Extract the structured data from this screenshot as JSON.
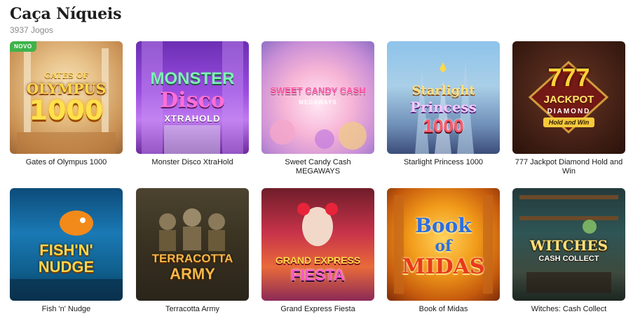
{
  "page": {
    "title": "Caça Níqueis",
    "count": "3937 Jogos"
  },
  "games": [
    {
      "name": "Gates of Olympus 1000",
      "badge": "NOVO",
      "logo_lines": [
        "GATES OF",
        "OLYMPUS",
        "1000"
      ]
    },
    {
      "name": "Monster Disco XtraHold",
      "logo_lines": [
        "MONSTER",
        "Disco",
        "XTRAHOLD"
      ]
    },
    {
      "name": "Sweet Candy Cash MEGAWAYS",
      "logo_lines": [
        "SWEET CANDY CASH",
        "MEGAWAYS"
      ]
    },
    {
      "name": "Starlight Princess 1000",
      "logo_lines": [
        "Starlight",
        "Princess",
        "1000"
      ]
    },
    {
      "name": "777 Jackpot Diamond Hold and Win",
      "logo_lines": [
        "777",
        "JACKPOT",
        "DIAMOND",
        "Hold and Win"
      ]
    },
    {
      "name": "Fish 'n' Nudge",
      "logo_lines": [
        "FISH'N'",
        "NUDGE"
      ]
    },
    {
      "name": "Terracotta Army",
      "logo_lines": [
        "TERRACOTTA",
        "ARMY"
      ]
    },
    {
      "name": "Grand Express Fiesta",
      "logo_lines": [
        "GRAND EXPRESS",
        "FIESTA"
      ]
    },
    {
      "name": "Book of Midas",
      "logo_lines": [
        "Book",
        "of",
        "MIDAS"
      ]
    },
    {
      "name": "Witches: Cash Collect",
      "logo_lines": [
        "WITCHES",
        "CASH COLLECT"
      ]
    }
  ]
}
